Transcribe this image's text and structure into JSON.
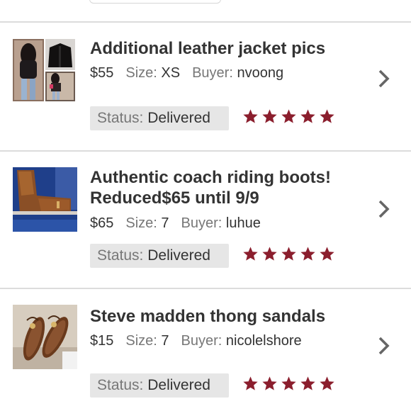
{
  "theme": {
    "star_color": "#8b1e2d",
    "status_bg": "#e6e6e6"
  },
  "labels": {
    "size": "Size:",
    "buyer": "Buyer:",
    "status": "Status:"
  },
  "items": [
    {
      "title": "Additional leather jacket pics",
      "price": "$55",
      "size": "XS",
      "buyer": "nvoong",
      "status": "Delivered",
      "rating": 5,
      "thumb": "leather-jacket-collage"
    },
    {
      "title": "Authentic coach riding boots! Reduced$65 until 9/9",
      "price": "$65",
      "size": "7",
      "buyer": "luhue",
      "status": "Delivered",
      "rating": 5,
      "thumb": "riding-boots-photo"
    },
    {
      "title": "Steve madden thong sandals",
      "price": "$15",
      "size": "7",
      "buyer": "nicolelshore",
      "status": "Delivered",
      "rating": 5,
      "thumb": "sandals-photo"
    }
  ]
}
